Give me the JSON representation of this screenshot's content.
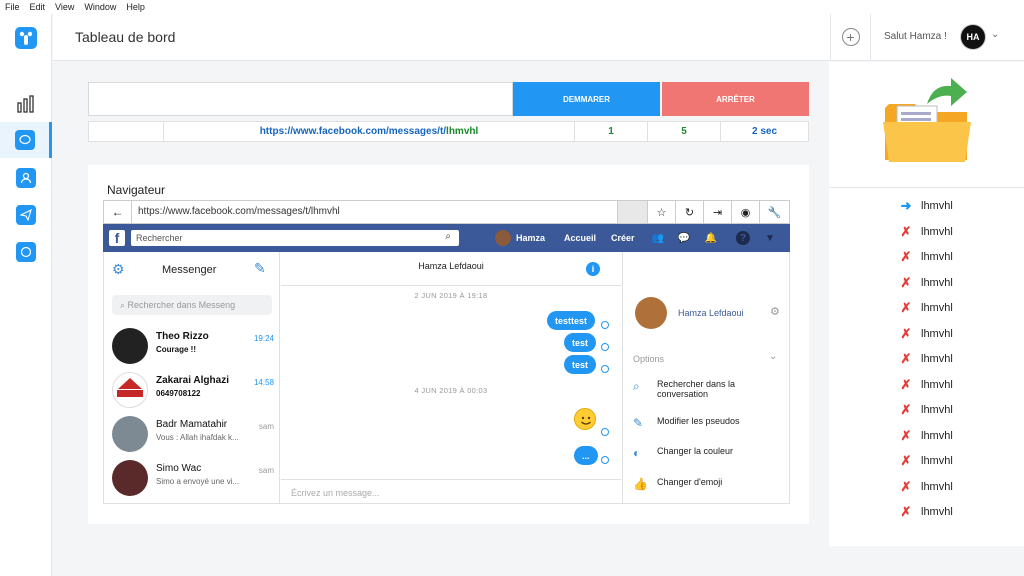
{
  "menubar": [
    "File",
    "Edit",
    "View",
    "Window",
    "Help"
  ],
  "header": {
    "title": "Tableau de bord",
    "greeting": "Salut Hamza !",
    "avatar_initials": "HA"
  },
  "controls": {
    "start_label": "DEMMARER",
    "stop_label": "ARRÊTER",
    "url_value": ""
  },
  "stats": {
    "url": "https://www.facebook.com/messages/t/",
    "url_user": "lhmvhl",
    "count1": "1",
    "count2": "5",
    "interval": "2 sec"
  },
  "browser": {
    "section_label": "Navigateur",
    "url": "https://www.facebook.com/messages/t/lhmvhl"
  },
  "facebook": {
    "search_placeholder": "Rechercher",
    "user": "Hamza",
    "home": "Accueil",
    "create": "Créer"
  },
  "messenger": {
    "title": "Messenger",
    "search_placeholder": "Rechercher dans Messeng",
    "conversations": [
      {
        "name": "Theo Rizzo",
        "message": "Courage !!",
        "time": "19:24",
        "unread": true
      },
      {
        "name": "Zakarai Alghazi",
        "message": "0649708122",
        "time": "14:58",
        "unread": true
      },
      {
        "name": "Badr Mamatahir",
        "message": "Vous : Allah ihafdak k...",
        "time": "sam",
        "unread": false
      },
      {
        "name": "Simo Wac",
        "message": "Simo a envoyé une vi...",
        "time": "sam",
        "unread": false
      }
    ],
    "chat_header": "Hamza Lefdaoui",
    "date1": "2 JUN 2019 À 19:18",
    "date2": "4 JUN 2019 À 00:03",
    "messages": [
      "testtest",
      "test",
      "test",
      "..."
    ],
    "compose_placeholder": "Écrivez un message...",
    "contact_name": "Hamza Lefdaoui",
    "options_label": "Options",
    "actions": [
      "Rechercher dans la conversation",
      "Modifier les pseudos",
      "Changer la couleur",
      "Changer d'emoji"
    ]
  },
  "targets": [
    {
      "name": "lhmvhl",
      "status": "current"
    },
    {
      "name": "lhmvhl",
      "status": "failed"
    },
    {
      "name": "lhmvhl",
      "status": "failed"
    },
    {
      "name": "lhmvhl",
      "status": "failed"
    },
    {
      "name": "lhmvhl",
      "status": "failed"
    },
    {
      "name": "lhmvhl",
      "status": "failed"
    },
    {
      "name": "lhmvhl",
      "status": "failed"
    },
    {
      "name": "lhmvhl",
      "status": "failed"
    },
    {
      "name": "lhmvhl",
      "status": "failed"
    },
    {
      "name": "lhmvhl",
      "status": "failed"
    },
    {
      "name": "lhmvhl",
      "status": "failed"
    },
    {
      "name": "lhmvhl",
      "status": "failed"
    },
    {
      "name": "lhmvhl",
      "status": "failed"
    }
  ],
  "colors": {
    "accent": "#2196f3",
    "stop": "#f07673",
    "facebook": "#3b5998",
    "fail": "#e53935"
  }
}
